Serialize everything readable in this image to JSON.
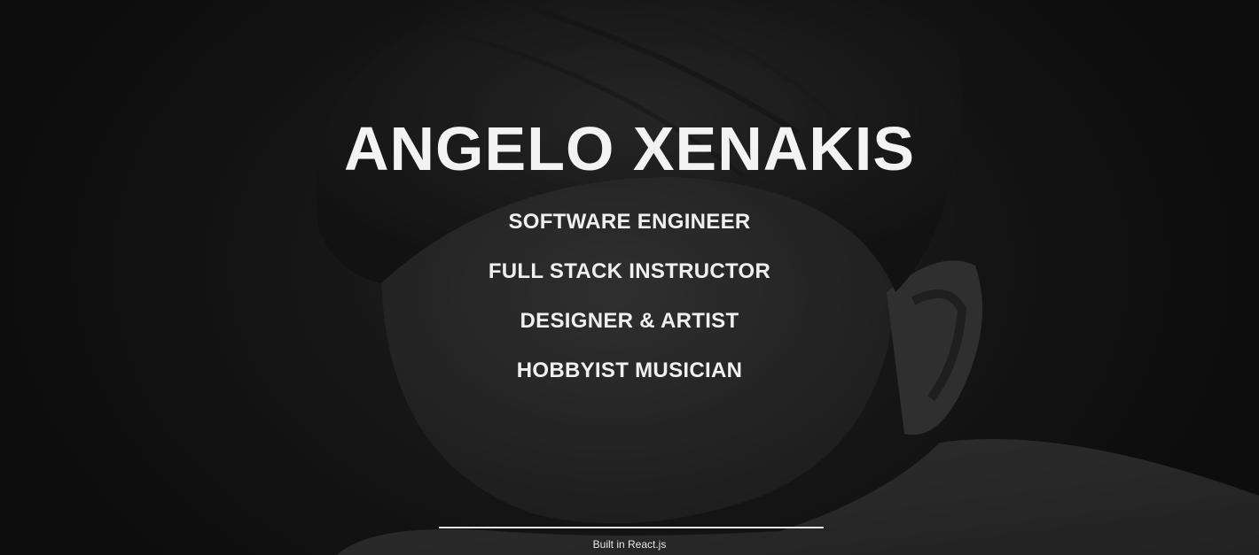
{
  "hero": {
    "name": "ANGELO XENAKIS",
    "roles": [
      "SOFTWARE ENGINEER",
      "FULL STACK INSTRUCTOR",
      "DESIGNER & ARTIST",
      "HOBBYIST MUSICIAN"
    ]
  },
  "footer": {
    "text": "Built in React.js"
  },
  "colors": {
    "background": "#121212",
    "text": "#f2f2f2",
    "divider": "#e6e6e6"
  }
}
